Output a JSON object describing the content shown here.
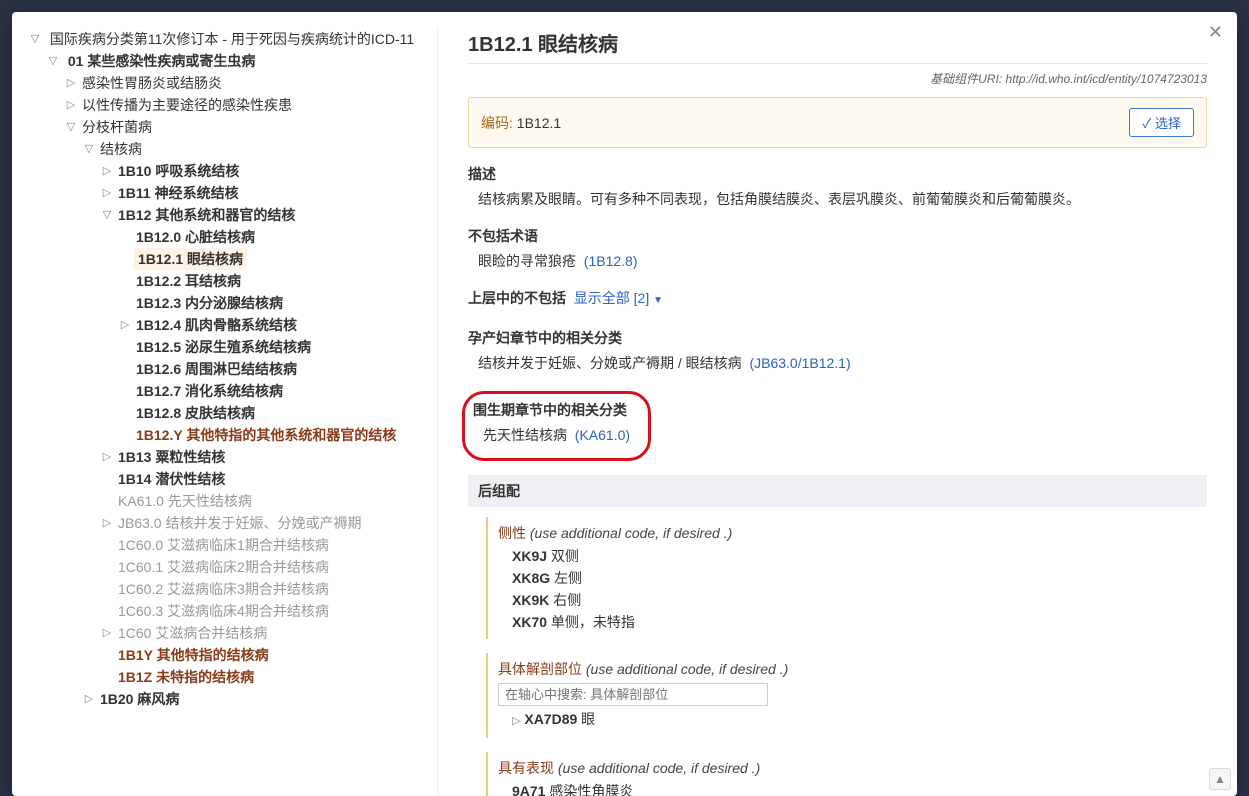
{
  "tree": {
    "root": "国际疾病分类第11次修订本 - 用于死因与疾病统计的ICD-11",
    "ch01": "01 某些感染性疾病或寄生虫病",
    "n1": "感染性胃肠炎或结肠炎",
    "n2": "以性传播为主要途径的感染性疾患",
    "n3": "分枝杆菌病",
    "n4": "结核病",
    "b10": "1B10 呼吸系统结核",
    "b11": "1B11 神经系统结核",
    "b12": "1B12 其他系统和器官的结核",
    "b120": "1B12.0 心脏结核病",
    "b121": "1B12.1 眼结核病",
    "b122": "1B12.2 耳结核病",
    "b123": "1B12.3 内分泌腺结核病",
    "b124": "1B12.4 肌肉骨骼系统结核",
    "b125": "1B12.5 泌尿生殖系统结核病",
    "b126": "1B12.6 周围淋巴结结核病",
    "b127": "1B12.7 消化系统结核病",
    "b128": "1B12.8 皮肤结核病",
    "b12y": "1B12.Y 其他特指的其他系统和器官的结核",
    "b13": "1B13 粟粒性结核",
    "b14": "1B14 潜伏性结核",
    "ka61": "KA61.0 先天性结核病",
    "jb63": "JB63.0 结核并发于妊娠、分娩或产褥期",
    "c600": "1C60.0 艾滋病临床1期合并结核病",
    "c601": "1C60.1 艾滋病临床2期合并结核病",
    "c602": "1C60.2 艾滋病临床3期合并结核病",
    "c603": "1C60.3 艾滋病临床4期合并结核病",
    "c60": "1C60 艾滋病合并结核病",
    "b1y": "1B1Y 其他特指的结核病",
    "b1z": "1B1Z 未特指的结核病",
    "b20": "1B20 麻风病"
  },
  "content": {
    "title": "1B12.1 眼结核病",
    "uri_label": "基础组件URI:",
    "uri_value": "http://id.who.int/icd/entity/1074723013",
    "code_label": "编码:",
    "code_value": "1B12.1",
    "select_btn": "选择",
    "desc_h": "描述",
    "desc_p": "结核病累及眼睛。可有多种不同表现，包括角膜结膜炎、表层巩膜炎、前葡葡膜炎和后葡葡膜炎。",
    "excl_h": "不包括术语",
    "excl_p1": "眼睑的寻常狼疮",
    "excl_p1_code": "(1B12.8)",
    "upper_h": "上层中的不包括",
    "upper_link": "显示全部 [2]",
    "preg_h": "孕产妇章节中的相关分类",
    "preg_p": "结核并发于妊娠、分娩或产褥期 / 眼结核病",
    "preg_code": "(JB63.0/1B12.1)",
    "peri_h": "围生期章节中的相关分类",
    "peri_p": "先天性结核病",
    "peri_code": "(KA61.0)",
    "post_h": "后组配",
    "axis1_title": "侧性",
    "axis_note": "(use additional code, if desired .)",
    "lat": [
      {
        "c": "XK9J",
        "t": "双侧"
      },
      {
        "c": "XK8G",
        "t": "左侧"
      },
      {
        "c": "XK9K",
        "t": "右侧"
      },
      {
        "c": "XK70",
        "t": "单侧，未特指"
      }
    ],
    "axis2_title": "具体解剖部位",
    "search_ph": "在轴心中搜索: 具体解剖部位",
    "axis2_item_c": "XA7D89",
    "axis2_item_t": "眼",
    "axis3_title": "具有表现",
    "axis3_item_c": "9A71",
    "axis3_item_t": "感染性角膜炎"
  }
}
